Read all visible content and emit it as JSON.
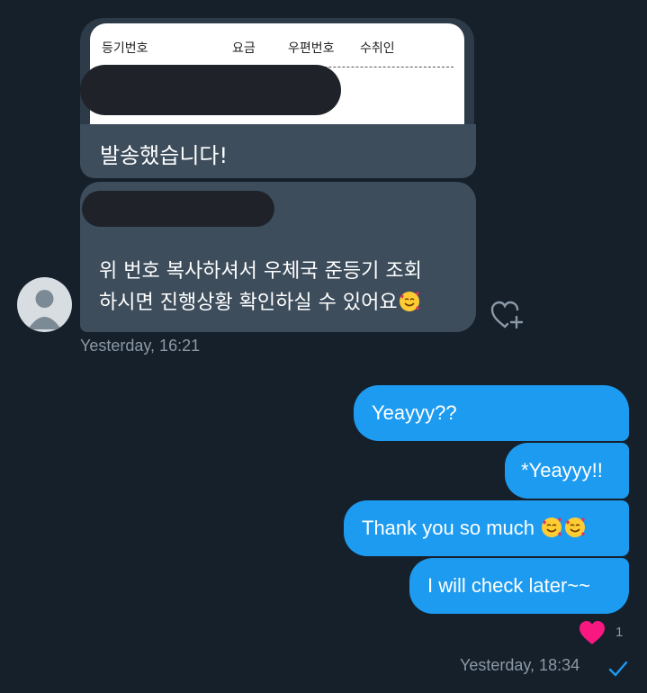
{
  "incoming": {
    "image_card": {
      "headers": [
        "등기번호",
        "요금",
        "우편번호",
        "수취인"
      ]
    },
    "bubble1_text": "발송했습니다!",
    "bubble2_line1": "위 번호 복사하셔서 우체국 준등기 조회",
    "bubble2_line2": "하시면 진행상황 확인하실 수 있어요",
    "timestamp": "Yesterday, 16:21",
    "emoji_icon": "smiling-face-with-hearts-icon"
  },
  "outgoing": {
    "messages": [
      {
        "text": "Yeayyy??"
      },
      {
        "text": "*Yeayyy!!"
      },
      {
        "text": "Thank you so much"
      },
      {
        "text": "I will check later~~"
      }
    ],
    "reaction_count": "1",
    "timestamp": "Yesterday, 18:34"
  },
  "colors": {
    "background": "#15202b",
    "incoming_bubble": "#3d4d5c",
    "outgoing_bubble": "#1d9bf0",
    "muted_text": "#8b98a5",
    "reaction_heart": "#f91880"
  }
}
